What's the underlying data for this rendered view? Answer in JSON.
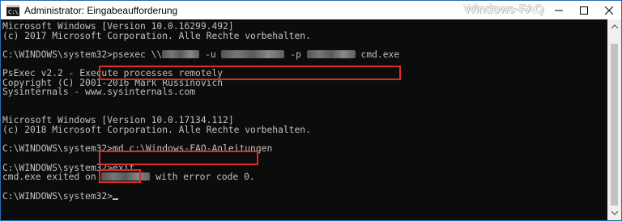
{
  "window": {
    "title": "Administrator: Eingabeaufforderung",
    "watermark": "Windows-FAQ",
    "icons": {
      "app": "cmd-icon",
      "minimize": "minimize-icon",
      "maximize": "maximize-icon",
      "close": "close-icon"
    }
  },
  "console": {
    "lines": [
      "Microsoft Windows [Version 10.0.16299.492]",
      "(c) 2017 Microsoft Corporation. Alle Rechte vorbehalten.",
      "",
      "C:\\WINDOWS\\system32>psexec \\\\",
      "",
      "PsExec v2.2 - Execute processes remotely",
      "Copyright (C) 2001-2016 Mark Russinovich",
      "Sysinternals - www.sysinternals.com",
      "",
      "",
      "Microsoft Windows [Version 10.0.17134.112]",
      "(c) 2018 Microsoft Corporation. Alle Rechte vorbehalten.",
      "",
      "C:\\WINDOWS\\system32>md c:\\Windows-FAQ-Anleitungen",
      "",
      "C:\\WINDOWS\\system32>exit",
      "cmd.exe exited on",
      "",
      "C:\\WINDOWS\\system32>"
    ],
    "psexec_flag_user": "-u",
    "psexec_flag_pass": "-p",
    "psexec_program": "cmd.exe",
    "exit_suffix": "with error code 0."
  },
  "colors": {
    "console_bg": "#0c0c0c",
    "console_text": "#c0c0c0",
    "highlight": "#e02b2b"
  }
}
